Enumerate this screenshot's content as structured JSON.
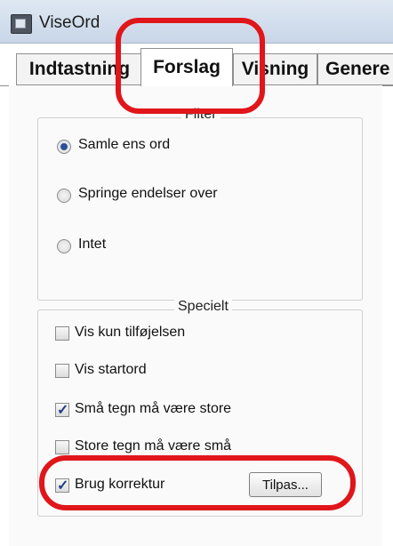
{
  "window": {
    "title": "ViseOrd",
    "icon": "app-window-icon"
  },
  "tabs": [
    {
      "label": "Indtastning",
      "active": false
    },
    {
      "label": "Forslag",
      "active": true
    },
    {
      "label": "Visning",
      "active": false
    },
    {
      "label": "Genere",
      "active": false
    }
  ],
  "filter": {
    "legend": "Filter",
    "options": [
      {
        "label": "Samle ens ord",
        "selected": true
      },
      {
        "label": "Springe endelser over",
        "selected": false
      },
      {
        "label": "Intet",
        "selected": false
      }
    ]
  },
  "special": {
    "legend": "Specielt",
    "options": [
      {
        "label": "Vis kun tilføjelsen",
        "checked": false
      },
      {
        "label": "Vis startord",
        "checked": false
      },
      {
        "label": "Små tegn må være store",
        "checked": true
      },
      {
        "label": "Store tegn må være små",
        "checked": false
      },
      {
        "label": "Brug korrektur",
        "checked": true
      }
    ],
    "adjust_button": "Tilpas..."
  },
  "colors": {
    "highlight": "#e0161a",
    "accent": "#2a4f96"
  }
}
